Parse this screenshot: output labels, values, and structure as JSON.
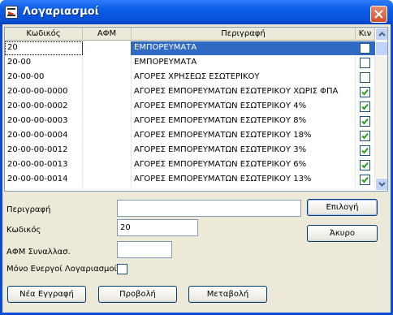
{
  "window": {
    "title": "Λογαριασμοί"
  },
  "grid": {
    "columns": [
      "Κωδικός",
      "ΑΦΜ",
      "Περιγραφή",
      "Κιν"
    ],
    "rows": [
      {
        "code": "20",
        "afm": "",
        "desc": "ΕΜΠΟΡΕΥΜΑΤΑ",
        "checked": false,
        "selected": true
      },
      {
        "code": "20-00",
        "afm": "",
        "desc": "ΕΜΠΟΡΕΥΜΑΤΑ",
        "checked": false,
        "selected": false
      },
      {
        "code": "20-00-00",
        "afm": "",
        "desc": "ΑΓΟΡΕΣ ΧΡΗΣΕΩΣ ΕΣΩΤΕΡΙΚΟΥ",
        "checked": false,
        "selected": false
      },
      {
        "code": "20-00-00-0000",
        "afm": "",
        "desc": "ΑΓΟΡΕΣ ΕΜΠΟΡΕΥΜΑΤΩΝ ΕΣΩΤΕΡΙΚΟΥ ΧΩΡΙΣ ΦΠΑ",
        "checked": true,
        "selected": false
      },
      {
        "code": "20-00-00-0002",
        "afm": "",
        "desc": "ΑΓΟΡΕΣ ΕΜΠΟΡΕΥΜΑΤΩΝ ΕΣΩΤΕΡΙΚΟΥ 4%",
        "checked": true,
        "selected": false
      },
      {
        "code": "20-00-00-0003",
        "afm": "",
        "desc": "ΑΓΟΡΕΣ ΕΜΠΟΡΕΥΜΑΤΩΝ ΕΣΩΤΕΡΙΚΟΥ 8%",
        "checked": true,
        "selected": false
      },
      {
        "code": "20-00-00-0004",
        "afm": "",
        "desc": "ΑΓΟΡΕΣ ΕΜΠΟΡΕΥΜΑΤΩΝ ΕΣΩΤΕΡΙΚΟΥ 18%",
        "checked": true,
        "selected": false
      },
      {
        "code": "20-00-00-0012",
        "afm": "",
        "desc": "ΑΓΟΡΕΣ ΕΜΠΟΡΕΥΜΑΤΩΝ ΕΣΩΤΕΡΙΚΟΥ 3%",
        "checked": true,
        "selected": false
      },
      {
        "code": "20-00-00-0013",
        "afm": "",
        "desc": "ΑΓΟΡΕΣ ΕΜΠΟΡΕΥΜΑΤΩΝ ΕΣΩΤΕΡΙΚΟΥ 6%",
        "checked": true,
        "selected": false
      },
      {
        "code": "20-00-00-0014",
        "afm": "",
        "desc": "ΑΓΟΡΕΣ ΕΜΠΟΡΕΥΜΑΤΩΝ ΕΣΩΤΕΡΙΚΟΥ 13%",
        "checked": true,
        "selected": false
      }
    ]
  },
  "form": {
    "description_label": "Περιγραφή",
    "description_value": "",
    "code_label": "Κωδικός",
    "code_value": "20",
    "afm_label": "ΑΦΜ Συναλλασ.",
    "afm_value": "",
    "active_only_label": "Μόνο Ενεργοί Λογαριασμοί",
    "active_only_checked": false
  },
  "buttons": {
    "select": "Επιλογή",
    "cancel": "Άκυρο",
    "new_entry": "Νέα Εγγραφή",
    "view": "Προβολή",
    "edit": "Μεταβολή"
  },
  "colors": {
    "titlebar": "#0a5ce6",
    "selection": "#316ac5",
    "dialog_bg": "#ece9d8",
    "check": "#21a121"
  }
}
